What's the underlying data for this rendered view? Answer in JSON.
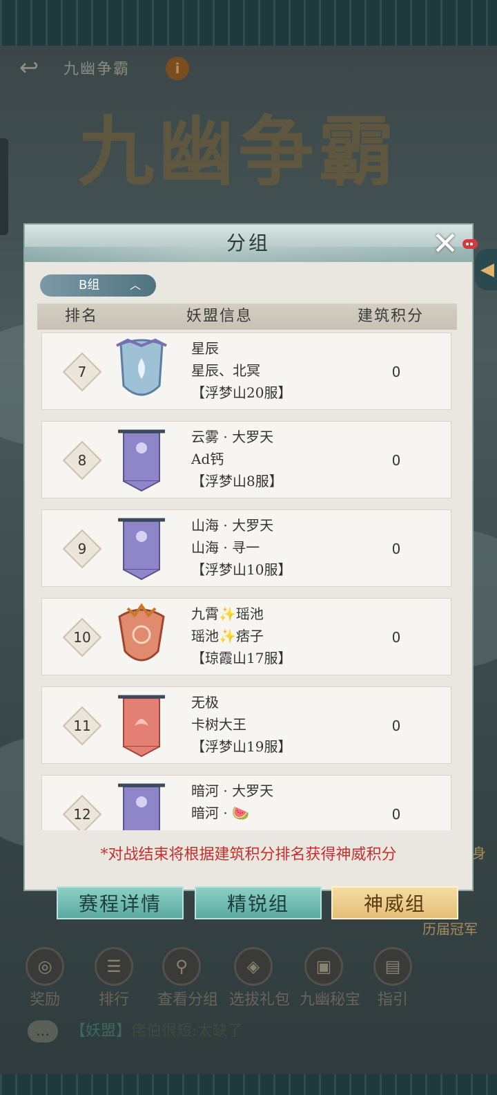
{
  "header": {
    "title": "九幽争霸",
    "info_icon": "i",
    "back_icon": "back-arrow-icon"
  },
  "banner_title": "九幽争霸",
  "modal": {
    "title": "分组",
    "close_icon": "close-icon",
    "group_tab": {
      "label": "B组",
      "chevron": "︿"
    },
    "columns": {
      "rank": "排名",
      "info": "妖盟信息",
      "score": "建筑积分"
    },
    "rows": [
      {
        "rank": "7",
        "name": "星辰",
        "leader": "星辰、北冥",
        "server": "【浮梦山20服】",
        "score": "0",
        "emblem": "blue-shield"
      },
      {
        "rank": "8",
        "name": "云雾 · 大罗天",
        "leader": "Ad钙",
        "server": "【浮梦山8服】",
        "score": "0",
        "emblem": "purple-banner"
      },
      {
        "rank": "9",
        "name": "山海 · 大罗天",
        "leader": "山海 · 寻一",
        "server": "【浮梦山10服】",
        "score": "0",
        "emblem": "purple-banner"
      },
      {
        "rank": "10",
        "name": "九霄✨瑶池",
        "leader": "瑶池✨痞子",
        "server": "【琼霞山17服】",
        "score": "0",
        "emblem": "red-crest"
      },
      {
        "rank": "11",
        "name": "无极",
        "leader": "卡树大王",
        "server": "【浮梦山19服】",
        "score": "0",
        "emblem": "red-banner"
      },
      {
        "rank": "12",
        "name": "暗河 · 大罗天",
        "leader": "暗河 · 🍉",
        "server": "",
        "score": "0",
        "emblem": "purple-banner"
      }
    ],
    "note": "*对战结束将根据建筑积分排名获得神威积分"
  },
  "buttons": {
    "schedule": "赛程详情",
    "elite": "精锐组",
    "divine": "神威组"
  },
  "side_text": "历届冠军",
  "side_text_top": "身",
  "bottom_icons": [
    {
      "label": "奖励",
      "icon": "reward-icon"
    },
    {
      "label": "排行",
      "icon": "ranking-icon"
    },
    {
      "label": "查看分组",
      "icon": "view-group-icon"
    },
    {
      "label": "选拔礼包",
      "icon": "gift-pack-icon"
    },
    {
      "label": "九幽秘宝",
      "icon": "treasure-icon"
    },
    {
      "label": "指引",
      "icon": "guide-icon"
    }
  ],
  "chat": {
    "channel": "【妖盟】",
    "message": "佬伯很短:太缺了"
  },
  "colors": {
    "accent_red": "#c6302c",
    "teal_button": "#5aa9a0",
    "gold_button": "#e4be78"
  }
}
